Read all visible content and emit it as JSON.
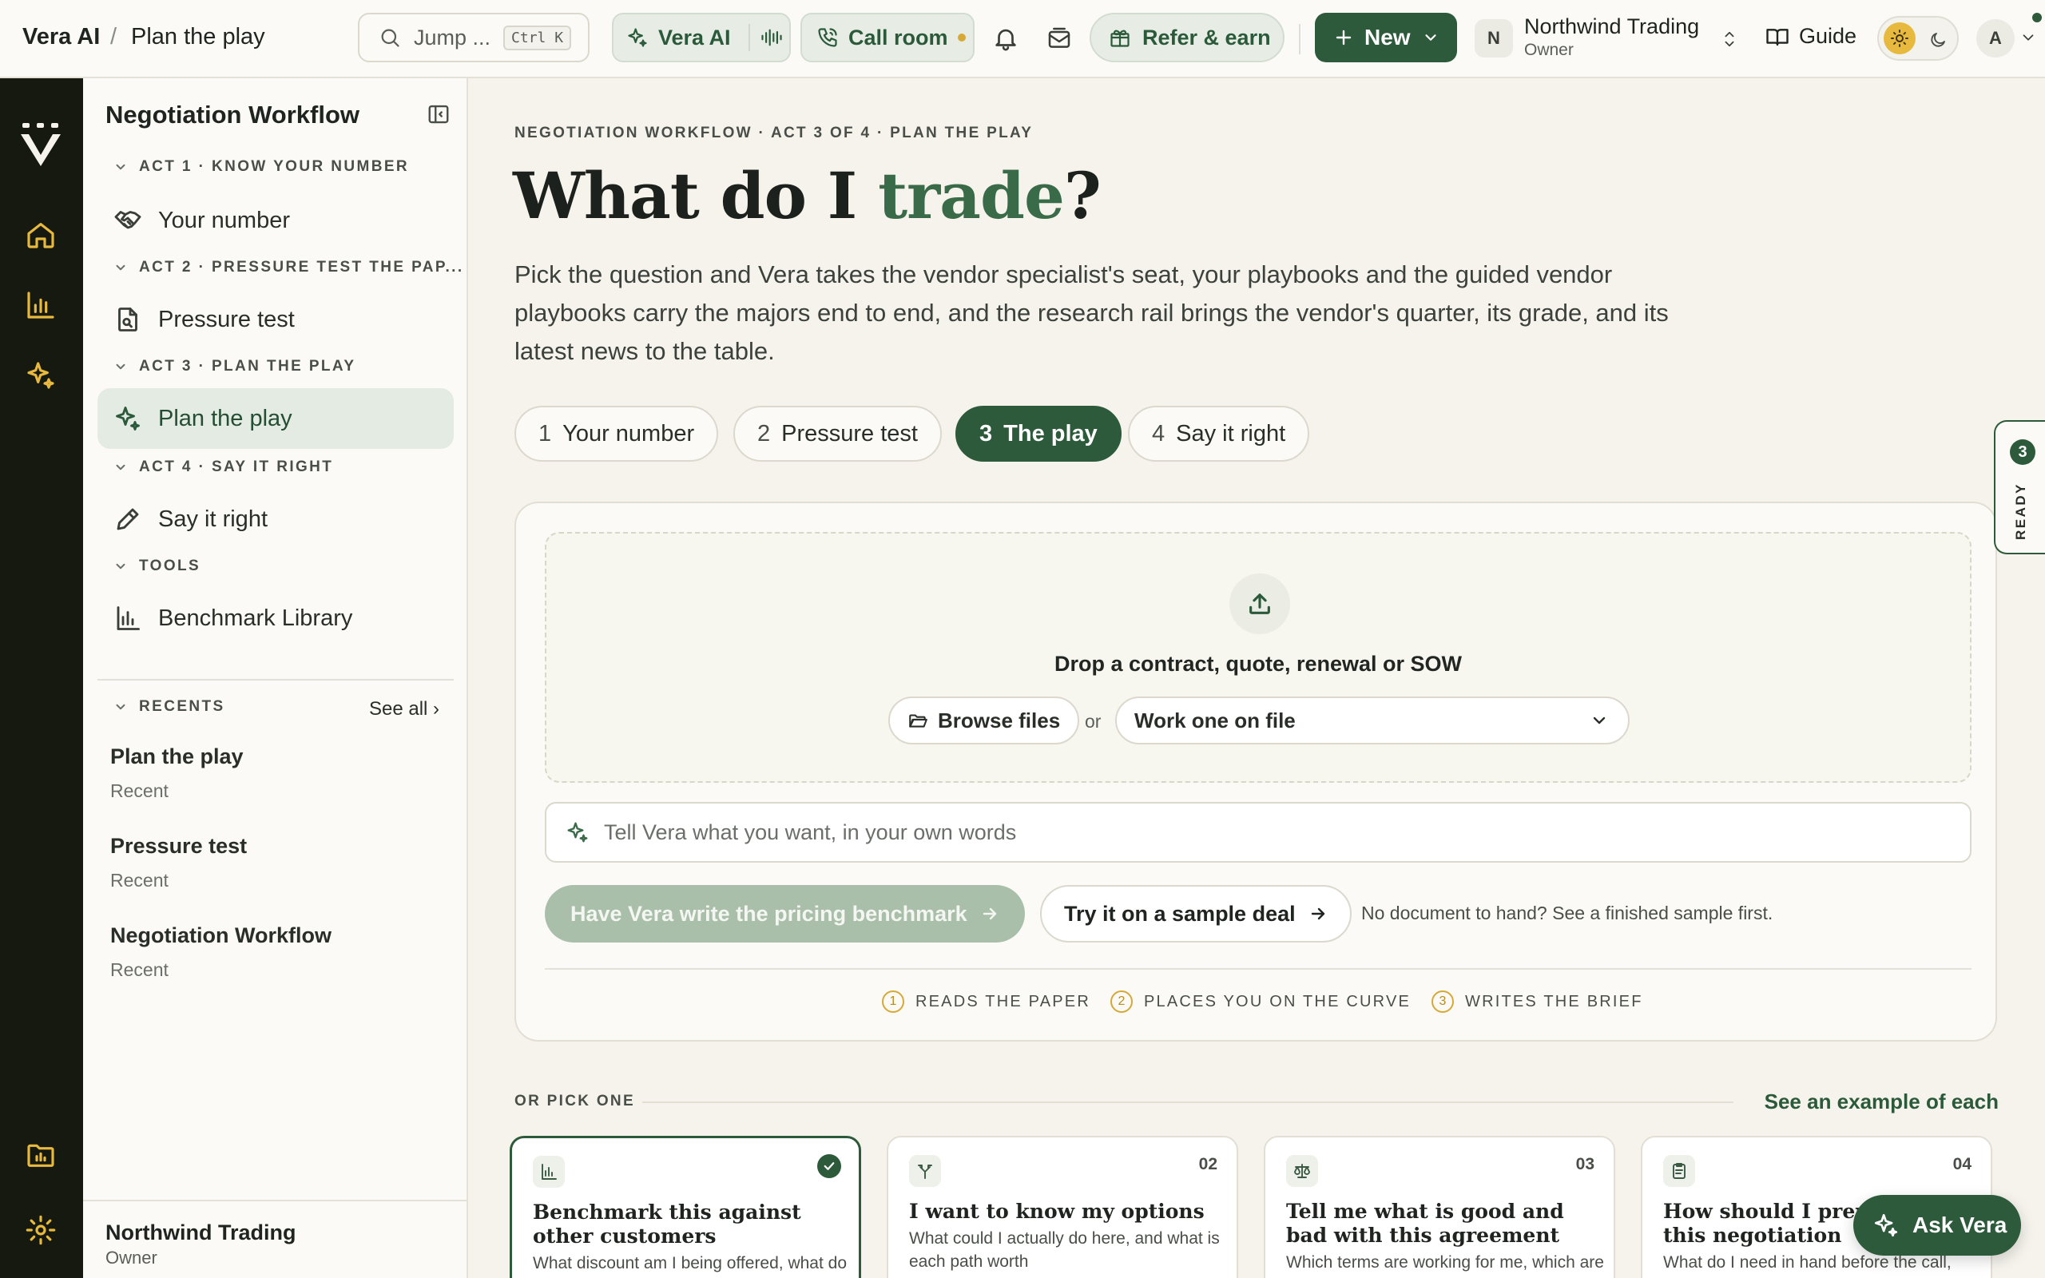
{
  "breadcrumb": {
    "root": "Vera AI",
    "sep": "/",
    "current": "Plan the play"
  },
  "search": {
    "placeholder": "Jump ...",
    "shortcut": "Ctrl K"
  },
  "topbar": {
    "vera_ai": "Vera AI",
    "call_room": "Call room",
    "refer": "Refer & earn",
    "new": "New",
    "org_initial": "N",
    "org_name": "Northwind Trading",
    "org_role": "Owner",
    "guide": "Guide",
    "user_initial": "A"
  },
  "sidebar": {
    "title": "Negotiation Workflow",
    "sections": [
      {
        "header": "ACT 1 · KNOW YOUR NUMBER",
        "item": "Your number",
        "icon": "handshake-icon"
      },
      {
        "header": "ACT 2 · PRESSURE TEST THE PAP...",
        "item": "Pressure test",
        "icon": "file-search-icon"
      },
      {
        "header": "ACT 3 · PLAN THE PLAY",
        "item": "Plan the play",
        "icon": "sparkles-icon"
      },
      {
        "header": "ACT 4 · SAY IT RIGHT",
        "item": "Say it right",
        "icon": "pencil-icon"
      },
      {
        "header": "TOOLS",
        "item": "Benchmark Library",
        "icon": "bar-chart-icon"
      }
    ],
    "recents_header": "RECENTS",
    "see_all": "See all ›",
    "recents": [
      {
        "title": "Plan the play",
        "sub": "Recent"
      },
      {
        "title": "Pressure test",
        "sub": "Recent"
      },
      {
        "title": "Negotiation Workflow",
        "sub": "Recent"
      }
    ],
    "footer": {
      "name": "Northwind Trading",
      "role": "Owner"
    }
  },
  "main": {
    "eyebrow": "NEGOTIATION WORKFLOW · ACT 3 OF 4 · PLAN THE PLAY",
    "title_part1": "What do I ",
    "title_accent": "trade",
    "title_end": "?",
    "lead": "Pick the question and Vera takes the vendor specialist's seat, your playbooks and the guided vendor playbooks carry the majors end to end, and the research rail brings the vendor's quarter, its grade, and its latest news to the table.",
    "steps": [
      {
        "n": "1",
        "label": "Your number"
      },
      {
        "n": "2",
        "label": "Pressure test"
      },
      {
        "n": "3",
        "label": "The play"
      },
      {
        "n": "4",
        "label": "Say it right"
      }
    ],
    "drop_title": "Drop a contract, quote, renewal or SOW",
    "browse": "Browse files",
    "or": "or",
    "file_select": "Work one on file",
    "ask_placeholder": "Tell Vera what you want, in your own words",
    "cta_primary": "Have Vera write the pricing benchmark",
    "cta_secondary": "Try it on a sample deal",
    "hint": "No document to hand? See a finished sample first.",
    "stages": [
      {
        "n": "1",
        "label": "READS THE PAPER"
      },
      {
        "n": "2",
        "label": "PLACES YOU ON THE CURVE"
      },
      {
        "n": "3",
        "label": "WRITES THE BRIEF"
      }
    ],
    "pick_header": "OR PICK ONE",
    "see_example": "See an example of each",
    "cards": [
      {
        "n": "",
        "title": "Benchmark this against other customers",
        "desc": "What discount am I being offered, what do comparable buyers actually get",
        "icon": "bar-chart-icon",
        "selected": true
      },
      {
        "n": "02",
        "title": "I want to know my options",
        "desc": "What could I actually do here, and what is each path worth",
        "icon": "split-arrow-icon",
        "selected": false
      },
      {
        "n": "03",
        "title": "Tell me what is good and bad with this agreement",
        "desc": "Which terms are working for me, which are working against me and why",
        "icon": "scale-icon",
        "selected": false
      },
      {
        "n": "04",
        "title": "How should I prepare for this negotiation",
        "desc": "What do I need in hand before the call, and in what order do I use it",
        "icon": "clipboard-icon",
        "selected": false
      }
    ]
  },
  "ready_tab": {
    "count": "3",
    "label": "READY"
  },
  "ask_vera": "Ask Vera",
  "colors": {
    "brand": "#2d5a3b",
    "accent_text": "#3a6b48",
    "rail": "#16190f",
    "rail_icon": "#e7b93e"
  }
}
